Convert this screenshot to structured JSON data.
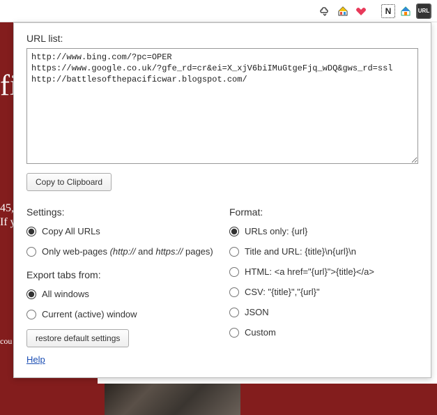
{
  "toolbar": {
    "icons": [
      "cloud-sync",
      "home-colored",
      "heart",
      "notion",
      "home-blue",
      "url-ext"
    ]
  },
  "bg": {
    "fi": "fi",
    "num": "45,",
    "ify": "If y",
    "cou": "cou"
  },
  "popup": {
    "urlListLabel": "URL list:",
    "urlTextarea": "http://www.bing.com/?pc=OPER\nhttps://www.google.co.uk/?gfe_rd=cr&ei=X_xjV6biIMuGtgeFjq_wDQ&gws_rd=ssl\nhttp://battlesofthepacificwar.blogspot.com/",
    "copyBtn": "Copy to Clipboard",
    "settings": {
      "heading": "Settings:",
      "copyAll": "Copy All URLs",
      "onlyWebPrefix": "Only web-pages ",
      "onlyWebItalic1": "(http://",
      "onlyWebMid": " and ",
      "onlyWebItalic2": "https://",
      "onlyWebSuffix": " pages)",
      "exportHeading": "Export tabs from:",
      "allWindows": "All windows",
      "currentWindow": "Current (active) window",
      "restoreBtn": "restore default settings"
    },
    "format": {
      "heading": "Format:",
      "urlsOnly": "URLs only: {url}",
      "titleUrl": "Title and URL: {title}\\n{url}\\n",
      "html": "HTML: <a href=\"{url}\">{title}</a>",
      "csv": "CSV: \"{title}\",\"{url}\"",
      "json": "JSON",
      "custom": "Custom"
    },
    "helpLink": "Help"
  }
}
